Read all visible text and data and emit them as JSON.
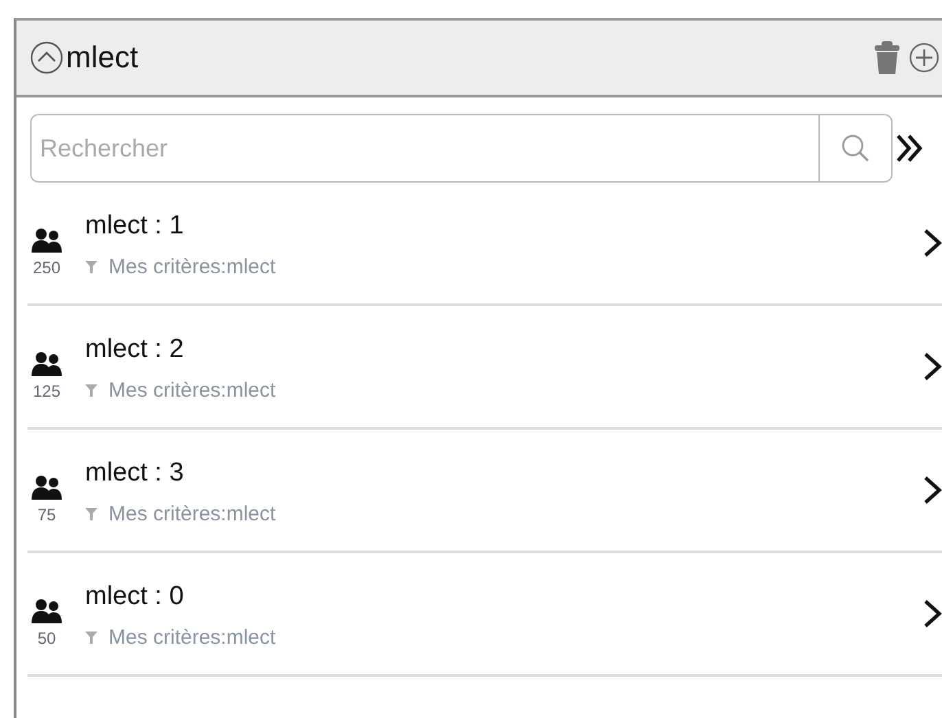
{
  "header": {
    "title": "mlect"
  },
  "search": {
    "placeholder": "Rechercher"
  },
  "items": [
    {
      "title": "mlect : 1",
      "count": "250",
      "criteria": "Mes critères:mlect"
    },
    {
      "title": "mlect : 2",
      "count": "125",
      "criteria": "Mes critères:mlect"
    },
    {
      "title": "mlect : 3",
      "count": "75",
      "criteria": "Mes critères:mlect"
    },
    {
      "title": "mlect : 0",
      "count": "50",
      "criteria": "Mes critères:mlect"
    }
  ]
}
